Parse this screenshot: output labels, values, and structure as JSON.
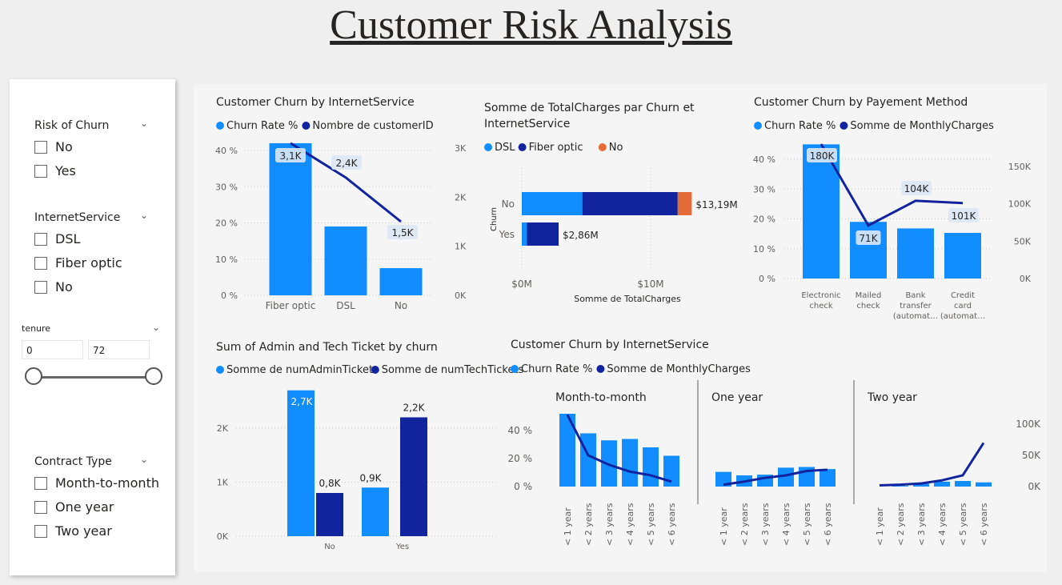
{
  "page_title": "Customer Risk Analysis",
  "slicers": {
    "risk": {
      "title": "Risk of Churn",
      "options": [
        "No",
        "Yes"
      ]
    },
    "internet": {
      "title": "InternetService",
      "options": [
        "DSL",
        "Fiber optic",
        "No"
      ]
    },
    "tenure": {
      "title": "tenure",
      "min": "0",
      "max": "72"
    },
    "contract": {
      "title": "Contract Type",
      "options": [
        "Month-to-month",
        "One year",
        "Two year"
      ]
    }
  },
  "colors": {
    "light_blue": "#118dff",
    "dark_blue": "#12239e",
    "orange": "#e66c37"
  },
  "chart_data": [
    {
      "type": "bar",
      "title": "Customer Churn by InternetService",
      "categories": [
        "Fiber optic",
        "DSL",
        "No"
      ],
      "legend": [
        "Churn Rate %",
        "Nombre de customerID"
      ],
      "series": [
        {
          "name": "Churn Rate %",
          "values": [
            42,
            19,
            7.5
          ],
          "axis": "left"
        },
        {
          "name": "Nombre de customerID",
          "values": [
            3100,
            2400,
            1500
          ],
          "labels": [
            "3,1K",
            "2,4K",
            "1,5K"
          ],
          "axis": "right",
          "kind": "line"
        }
      ],
      "left_ticks": [
        "40 %",
        "30 %",
        "20 %",
        "10 %",
        "0 %"
      ],
      "right_ticks": [
        "3K",
        "2K",
        "1K",
        "0K"
      ],
      "ylim_left": [
        0,
        45
      ],
      "ylim_right": [
        0,
        3260
      ]
    },
    {
      "type": "bar",
      "title": "Somme de TotalCharges par Churn et InternetService",
      "orientation": "horizontal",
      "categories": [
        "No",
        "Yes"
      ],
      "legend": [
        "DSL",
        "Fiber optic",
        "No"
      ],
      "series": [
        {
          "name": "DSL",
          "values": [
            4.7,
            0.4
          ]
        },
        {
          "name": "Fiber optic",
          "values": [
            7.4,
            2.46
          ]
        },
        {
          "name": "No",
          "values": [
            1.09,
            0
          ]
        }
      ],
      "totals": [
        "$13,19M",
        "$2,86M"
      ],
      "xlabel": "Somme de TotalCharges",
      "ylabel": "Churn",
      "x_ticks": [
        "$0M",
        "$10M"
      ],
      "xlim": [
        0,
        12
      ]
    },
    {
      "type": "bar",
      "title": "Customer Churn by Payement Method",
      "categories": [
        "Electronic check",
        "Mailed check",
        "Bank transfer (automat…",
        "Credit card (automat…"
      ],
      "legend": [
        "Churn Rate %",
        "Somme de MonthlyCharges"
      ],
      "series": [
        {
          "name": "Churn Rate %",
          "values": [
            45,
            19,
            16.8,
            15.3
          ],
          "axis": "left"
        },
        {
          "name": "Somme de MonthlyCharges",
          "values": [
            180000,
            71000,
            104000,
            101000
          ],
          "labels": [
            "180K",
            "71K",
            "104K",
            "101K"
          ],
          "axis": "right",
          "kind": "line"
        }
      ],
      "left_ticks": [
        "40 %",
        "30 %",
        "20 %",
        "10 %",
        "0 %"
      ],
      "right_ticks": [
        "150K",
        "100K",
        "50K",
        "0K"
      ],
      "ylim_left": [
        0,
        45
      ],
      "ylim_right": [
        0,
        180000
      ]
    },
    {
      "type": "bar",
      "title": "Sum of Admin and Tech Ticket by churn",
      "categories": [
        "No",
        "Yes"
      ],
      "legend": [
        "Somme de numAdminTickets",
        "Somme de numTechTickets"
      ],
      "series": [
        {
          "name": "Somme de numAdminTickets",
          "values": [
            2700,
            900
          ],
          "labels": [
            "2,7K",
            "0,9K"
          ]
        },
        {
          "name": "Somme de numTechTickets",
          "values": [
            800,
            2200
          ],
          "labels": [
            "0,8K",
            "2,2K"
          ]
        }
      ],
      "y_ticks": [
        "2K",
        "1K",
        "0K"
      ],
      "ylim": [
        0,
        2800
      ]
    },
    {
      "type": "bar",
      "title": "Customer Churn by InternetService",
      "legend": [
        "Churn Rate %",
        "Somme de MonthlyCharges"
      ],
      "categories": [
        "< 1 year",
        "< 2 years",
        "< 3 years",
        "< 4 years",
        "< 5 years",
        "< 6 years"
      ],
      "left_ticks": [
        "40 %",
        "20 %",
        "0 %"
      ],
      "right_ticks": [
        "100K",
        "50K",
        "0K"
      ],
      "ylim_left": [
        0,
        50
      ],
      "ylim_right": [
        0,
        100000
      ],
      "panels": [
        {
          "name": "Month-to-month",
          "churn": [
            52,
            38,
            33,
            34,
            28,
            22
          ],
          "charges": [
            115000,
            50000,
            35000,
            24000,
            18000,
            8000
          ]
        },
        {
          "name": "One year",
          "churn": [
            10.5,
            8,
            8.5,
            13.5,
            14,
            12.5
          ],
          "charges": [
            3000,
            8000,
            14000,
            18000,
            25000,
            27000
          ]
        },
        {
          "name": "Two year",
          "churn": [
            0,
            0.5,
            2,
            3.5,
            4,
            3
          ],
          "charges": [
            2000,
            3000,
            5000,
            10000,
            18000,
            70000
          ]
        }
      ]
    }
  ]
}
